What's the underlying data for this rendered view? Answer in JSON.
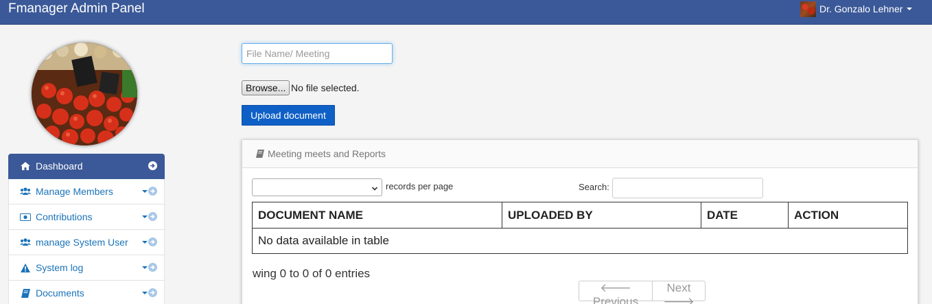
{
  "header": {
    "title": "Fmanager Admin Panel",
    "user_name": "Dr. Gonzalo Lehner"
  },
  "sidebar": {
    "items": [
      {
        "label": "Dashboard",
        "icon": "home-icon"
      },
      {
        "label": "Manage Members",
        "icon": "users-icon"
      },
      {
        "label": "Contributions",
        "icon": "money-icon"
      },
      {
        "label": "manage System User",
        "icon": "users-icon"
      },
      {
        "label": "System log",
        "icon": "warning-icon"
      },
      {
        "label": "Documents",
        "icon": "book-icon"
      }
    ]
  },
  "upload_form": {
    "file_name_placeholder": "File Name/ Meeting",
    "browse_label": "Browse...",
    "file_status": "No file selected.",
    "upload_label": "Upload document"
  },
  "panel": {
    "heading": "Meeting meets and Reports",
    "length_label": "records per page",
    "search_label": "Search:",
    "columns": [
      "DOCUMENT NAME",
      "UPLOADED BY",
      "DATE",
      "ACTION"
    ],
    "empty_text": "No data available in table",
    "info": "wing 0 to 0 of 0 entries",
    "prev_label": "Previous",
    "next_label": "Next"
  },
  "colors": {
    "header_bg": "#3b5998",
    "accent_blue": "#0f60c6",
    "link_blue": "#1a73b8"
  }
}
